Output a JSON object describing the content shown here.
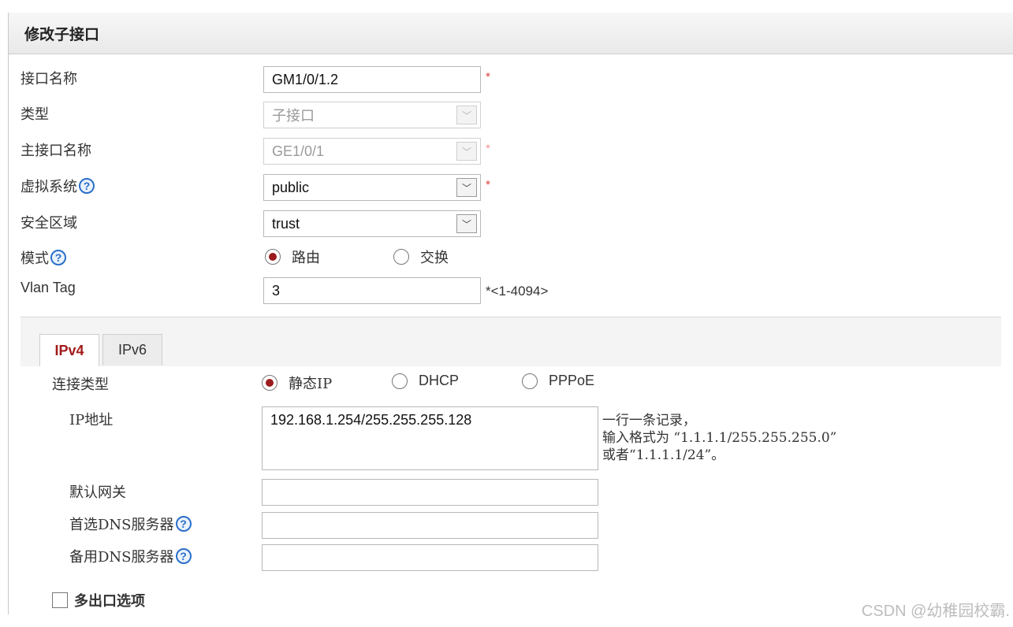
{
  "dialog": {
    "title": "修改子接口"
  },
  "fields": {
    "interface_name": {
      "label": "接口名称",
      "value": "GM1/0/1.2",
      "required": "*"
    },
    "type": {
      "label": "类型",
      "value": "子接口"
    },
    "main_interface": {
      "label": "主接口名称",
      "value": "GE1/0/1",
      "required": "*"
    },
    "virtual_system": {
      "label": "虚拟系统",
      "value": "public",
      "required": "*"
    },
    "security_zone": {
      "label": "安全区域",
      "value": "trust"
    },
    "mode": {
      "label": "模式",
      "options": [
        "路由",
        "交换"
      ],
      "selected": "路由"
    },
    "vlan_tag": {
      "label": "Vlan Tag",
      "value": "3",
      "hint": "*<1-4094>"
    }
  },
  "tabs": [
    {
      "label": "IPv4",
      "active": true
    },
    {
      "label": "IPv6",
      "active": false
    }
  ],
  "ipv4": {
    "connection_type": {
      "label": "连接类型",
      "options": [
        "静态IP",
        "DHCP",
        "PPPoE"
      ],
      "selected": "静态IP"
    },
    "ip_address": {
      "label": "IP地址",
      "value": "192.168.1.254/255.255.255.128",
      "hint_lines": [
        "一行一条记录，",
        "输入格式为 “1.1.1.1/255.255.255.0”",
        "或者“1.1.1.1/24”。"
      ]
    },
    "gateway": {
      "label": "默认网关",
      "value": ""
    },
    "dns_primary": {
      "label": "首选DNS服务器",
      "value": ""
    },
    "dns_secondary": {
      "label": "备用DNS服务器",
      "value": ""
    },
    "multi_exit": {
      "label": "多出口选项",
      "checked": false
    }
  },
  "help_glyph": "?",
  "caret_glyph": "﹀",
  "watermark": "CSDN @幼稚园校霸.",
  "colors": {
    "accent_red": "#9b1c1c",
    "help_blue": "#2a6fc9",
    "required_red": "#d22"
  }
}
